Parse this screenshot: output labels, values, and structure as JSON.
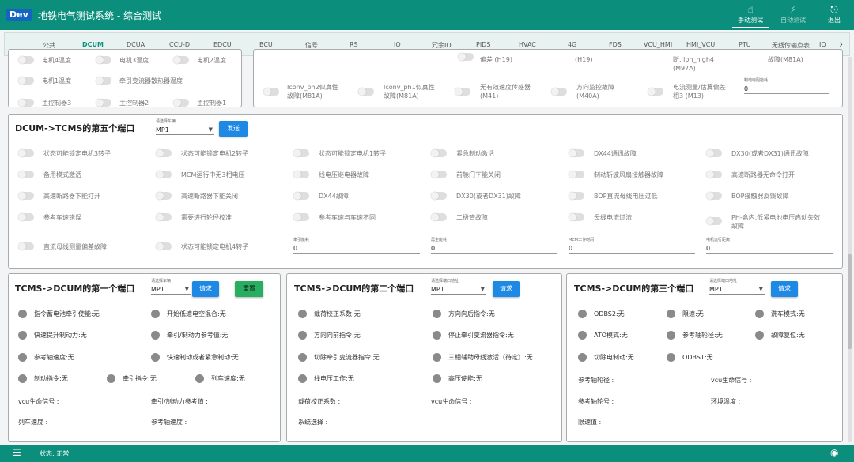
{
  "header": {
    "logo": "Dev",
    "title": "地铁电气测试系统 - 综合测试",
    "buttons": [
      {
        "label": "手动测试",
        "icon": "hand-icon"
      },
      {
        "label": "自动测试",
        "icon": "auto-icon"
      },
      {
        "label": "退出",
        "icon": "exit-icon"
      }
    ]
  },
  "tabs": [
    "公共",
    "DCUM",
    "DCUA",
    "CCU-D",
    "EDCU",
    "BCU",
    "信号",
    "RS",
    "IO",
    "冗余IO",
    "PIDS",
    "HVAC",
    "4G",
    "FDS",
    "VCU_HMI",
    "HMI_VCU",
    "PTU",
    "无线传输点表",
    "IO"
  ],
  "top_panel": {
    "left_items": [
      "电机4温度",
      "电机3温度",
      "电机2温度",
      "电机1温度",
      "牵引变流器散热器温度",
      "主控制器3",
      "主控制器2",
      "主控制器1"
    ],
    "right_items_partial": [
      "偏差 (H19)",
      "(H19)",
      "断, lph_high4",
      "(M97A)",
      "故障(M81A)"
    ],
    "right_items": [
      {
        "l1": "Iconv_ph2似真性",
        "l2": "故障(M81A)"
      },
      {
        "l1": "Iconv_ph1似真性",
        "l2": "故障(M81A)"
      },
      {
        "l1": "无有效速度传感器",
        "l2": "(M41)"
      },
      {
        "l1": "方向监控故障",
        "l2": "(M40A)"
      },
      {
        "l1": "电流测量/估算偏差",
        "l2": "相3 (M13)"
      }
    ],
    "field": {
      "caption": "制动电阻能耗",
      "value": "0"
    }
  },
  "port5": {
    "title": "DCUM->TCMS的第五个端口",
    "select_caption": "请选择车辆",
    "select_value": "MP1",
    "send": "发送",
    "rows": [
      [
        "状态可能锁定电机3转子",
        "状态可能锁定电机2转子",
        "状态可能锁定电机1转子",
        "紧急制动激活",
        "DX44通讯故障",
        "DX30(或者DX31)通讯故障"
      ],
      [
        "备用模式激活",
        "MCM运行中无3相电压",
        "线电压继电器故障",
        "前舱门下能关闭",
        "制动斩波风扇接触器故障",
        "高速断路器无命令打开"
      ],
      [
        "高速断路器下能打开",
        "高速断路器下能关闭",
        "DX44故障",
        "DX30(或者DX31)故障",
        "BOP直流母线电压过低",
        "BOP接触器反馈故障"
      ],
      [
        "参考车速错误",
        "需要进行轮径校准",
        "参考车速与车速不同",
        "二极管故障",
        "母线电流过流",
        "PH-盒内,低紧电池电压启动失效|故障"
      ],
      [
        "直流母线测量偏差故障",
        "状态可能锁定电机4转子"
      ]
    ],
    "fields": [
      {
        "caption": "牵引能耗",
        "value": "0"
      },
      {
        "caption": "再生能耗",
        "value": "0"
      },
      {
        "caption": "MCM工作时间",
        "value": "0"
      },
      {
        "caption": "电机运行距离",
        "value": "0"
      }
    ]
  },
  "port1": {
    "title": "TCMS->DCUM的第一个端口",
    "select_caption": "请选择车辆",
    "select_value": "MP1",
    "request": "请求",
    "reset": "重置",
    "indicators": [
      [
        "指令蓄电池牵引使能:无",
        "开始低速电空混合:无"
      ],
      [
        "快速提升制动力:无",
        "牵引/制动力参考值:无"
      ],
      [
        "参考轴速度:无",
        "快速制动或者紧急制动:无"
      ],
      [
        "制动指令:无",
        "牵引指令:无",
        "列车速度:无"
      ]
    ],
    "fields": [
      [
        "vcu生命信号 :",
        "牵引/制动力参考值 :"
      ],
      [
        "列车速度 :",
        "参考轴速度 :"
      ]
    ]
  },
  "port2": {
    "title": "TCMS->DCUM的第二个端口",
    "select_caption": "请选择端口地址",
    "select_value": "MP1",
    "request": "请求",
    "indicators": [
      [
        "载荷校正系数:无",
        "方向向后指令:无"
      ],
      [
        "方向向前指令:无",
        "停止牵引变流器指令:无"
      ],
      [
        "切除牵引变流器指令:无",
        "三相辅助母线激活（待定）:无"
      ],
      [
        "线电压工作:无",
        "高压使能:无"
      ]
    ],
    "fields": [
      [
        "载荷校正系数 :",
        "vcu生命信号 :"
      ],
      [
        "系统选择 :"
      ]
    ]
  },
  "port3": {
    "title": "TCMS->DCUM的第三个端口",
    "select_caption": "请选择端口地址",
    "select_value": "MP1",
    "request": "请求",
    "indicators": [
      [
        "ODBS2:无",
        "限速:无",
        "洗车模式:无"
      ],
      [
        "ATO模式:无",
        "参考轴轮径:无",
        "故障复位:无"
      ],
      [
        "切除电制动:无",
        "ODBS1:无"
      ]
    ],
    "fields": [
      [
        "参考轴轮径 :",
        "vcu生命信号 :"
      ],
      [
        "参考轴轮号 :",
        "环境温度 :"
      ],
      [
        "限速值 :"
      ]
    ]
  },
  "footer": {
    "status": "状态: 正常"
  },
  "colors": {
    "header": "#0b8f7c",
    "accent": "#1e88e5",
    "reset": "#27ae60"
  }
}
